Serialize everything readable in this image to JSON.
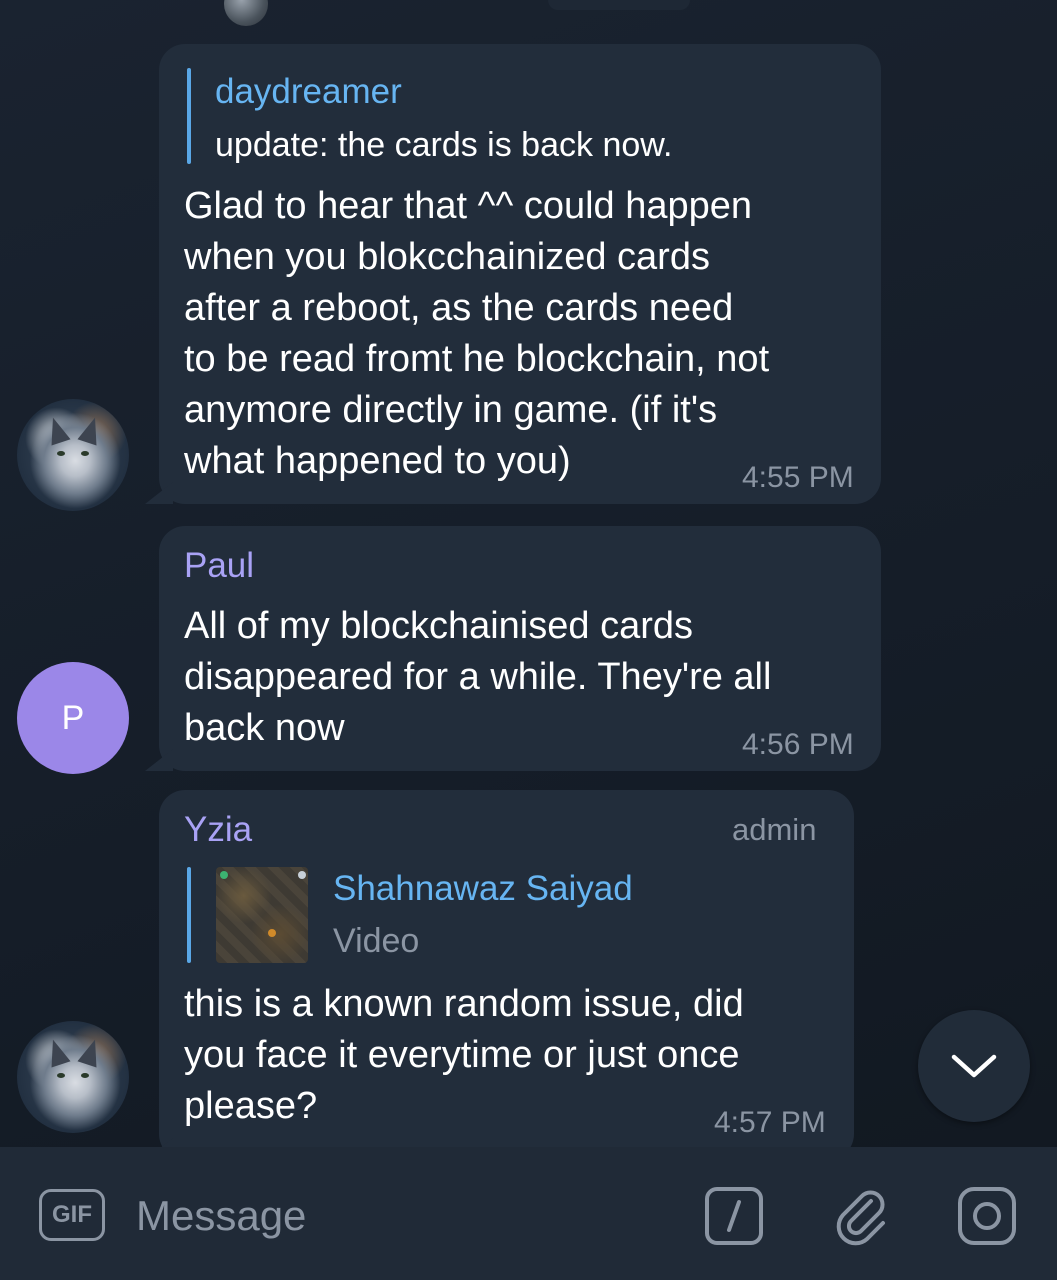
{
  "messages": [
    {
      "reply": {
        "sender": "daydreamer",
        "text": "update: the cards is back now."
      },
      "text": "Glad to hear that ^^ could happen\nwhen you blokcchainized cards\nafter a reboot, as the cards need\nto be read fromt he blockchain, not\nanymore directly in game. (if it's\nwhat happened to you)",
      "time": "4:55 PM"
    },
    {
      "sender": "Paul",
      "avatar_letter": "P",
      "text": "All of my blockchainised cards\ndisappeared for a while. They're all\nback now",
      "time": "4:56 PM"
    },
    {
      "sender": "Yzia",
      "role": "admin",
      "reply": {
        "sender": "Shahnawaz Saiyad",
        "text": "Video"
      },
      "text": "this is a known random issue, did\nyou face it everytime or just once\nplease?",
      "time": "4:57 PM"
    }
  ],
  "input": {
    "gif_label": "GIF",
    "placeholder": "Message"
  },
  "icons": {
    "scroll_down": "chevron-down-icon",
    "commands": "slash-command-icon",
    "attach": "paperclip-icon",
    "camera": "camera-icon"
  },
  "colors": {
    "background": "#151d28",
    "bubble": "#222d3b",
    "accent_blue": "#67b5f2",
    "accent_purple": "#a9a2f5",
    "avatar_p": "#9b87e8",
    "muted": "#8b95a3"
  }
}
